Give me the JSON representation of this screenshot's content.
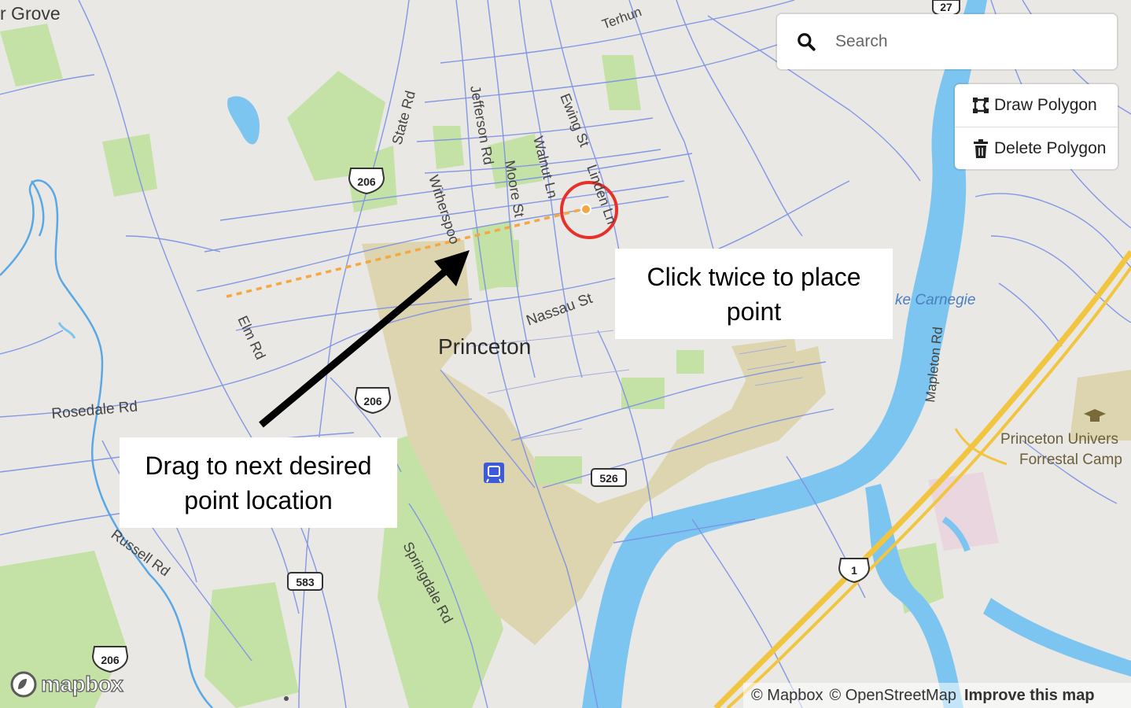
{
  "search": {
    "placeholder": "Search"
  },
  "controls": {
    "draw_polygon": "Draw Polygon",
    "delete_polygon": "Delete Polygon"
  },
  "callouts": {
    "click_line1": "Click twice to place",
    "click_line2": "point",
    "drag_line1": "Drag to next desired",
    "drag_line2": "point location"
  },
  "map_labels": {
    "grove": "r Grove",
    "princeton": "Princeton",
    "state_rd": "State Rd",
    "jefferson_rd": "Jefferson Rd",
    "moore_st": "Moore St",
    "walnut_ln": "Walnut Ln",
    "ewing_st": "Ewing St",
    "linden_ln": "Linden Ln",
    "witherspoon": "Witherspoo",
    "elm_rd": "Elm Rd",
    "nassau_st": "Nassau St",
    "rosedale_rd": "Rosedale Rd",
    "russell_rd": "Russell Rd",
    "springdale_rd": "Springdale Rd",
    "mapleton_rd": "Mapleton Rd",
    "terhune": "Terhun",
    "lake_carnegie": "ke Carnegie",
    "forrestal_1": "Princeton Univers",
    "forrestal_2": "Forrestal Camp"
  },
  "shields": {
    "us206_a": "206",
    "us206_b": "206",
    "us206_c": "206",
    "r27": "27",
    "r583": "583",
    "r526": "526",
    "us1": "1"
  },
  "branding": {
    "logo": "mapbox"
  },
  "attribution": {
    "mapbox": "© Mapbox",
    "osm": "© OpenStreetMap",
    "improve": "Improve this map"
  },
  "colors": {
    "land": "#e9e8e4",
    "park": "#c5e2a6",
    "campus": "#ddd5b0",
    "water": "#7cc5f0",
    "road": "#7a8fe6",
    "highway": "#f2c541",
    "draw_line": "#f5a742",
    "highlight_circle": "#e8302a"
  }
}
